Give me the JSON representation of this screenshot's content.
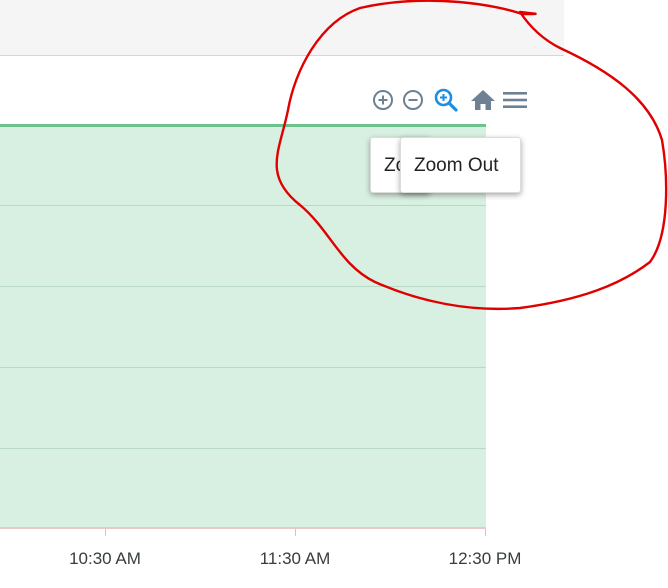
{
  "toolbar": {
    "icons": [
      "zoom-in-icon",
      "zoom-out-icon",
      "zoom-magnifier-icon",
      "home-icon",
      "menu-icon"
    ],
    "active_color": "#1a8fe3",
    "icon_color": "#6e8192"
  },
  "tooltips": {
    "back_label": "Zo",
    "front_label": "Zoom Out"
  },
  "chart_data": {
    "type": "area",
    "x_tick_labels": [
      "10:30 AM",
      "11:30 AM",
      "12:30 PM"
    ],
    "fill_color": "#d8f0e1",
    "line_color": "#6cc28a",
    "grid": true
  },
  "annotation": {
    "shape": "hand-drawn circle",
    "color": "#e00000"
  }
}
